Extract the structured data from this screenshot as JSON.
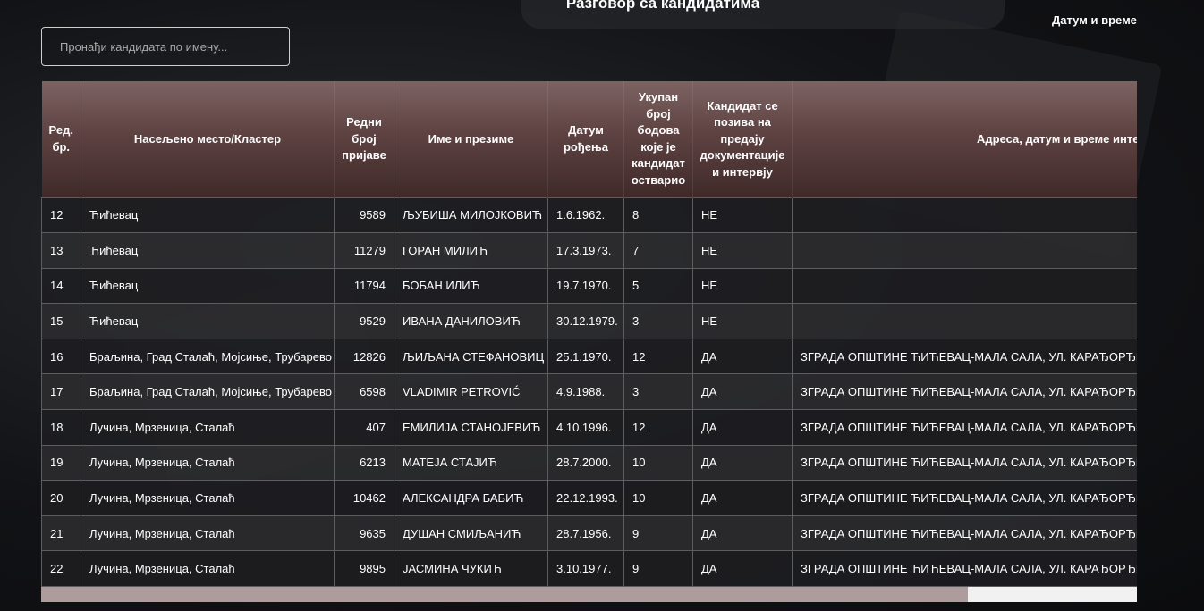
{
  "header": {
    "title": "Разговор са кандидатима",
    "date_label": "Датум и време"
  },
  "search": {
    "placeholder": "Пронађи кандидата по имену..."
  },
  "table": {
    "columns": [
      "Ред. бр.",
      "Насељено место/Кластер",
      "Редни број пријаве",
      "Име и презиме",
      "Датум рођења",
      "Укупан број бодова које је кандидат остварио",
      "Кандидат се позива на предају документације и интервју",
      "Адреса, датум и време интер"
    ],
    "rows": [
      [
        "12",
        "Ћићевац",
        "9589",
        "ЉУБИША МИЛОЈКОВИЋ",
        "1.6.1962.",
        "8",
        "НЕ",
        ""
      ],
      [
        "13",
        "Ћићевац",
        "11279",
        "ГОРАН МИЛИЋ",
        "17.3.1973.",
        "7",
        "НЕ",
        ""
      ],
      [
        "14",
        "Ћићевац",
        "11794",
        "БОБАН ИЛИЋ",
        "19.7.1970.",
        "5",
        "НЕ",
        ""
      ],
      [
        "15",
        "Ћићевац",
        "9529",
        "ИВАНА ДАНИЛОВИЋ",
        "30.12.1979.",
        "3",
        "НЕ",
        ""
      ],
      [
        "16",
        "Браљина, Град Сталаћ, Мојсиње, Трубарево",
        "12826",
        "ЉИЉАНА СТЕФАНОВИЦ",
        "25.1.1970.",
        "12",
        "ДА",
        "ЗГРАДА ОПШТИНЕ ЋИЋЕВАЦ-МАЛА САЛА, УЛ. КАРАЂОРЂЕВА"
      ],
      [
        "17",
        "Браљина, Град Сталаћ, Мојсиње, Трубарево",
        "6598",
        "VLADIMIR PETROVIĆ",
        "4.9.1988.",
        "3",
        "ДА",
        "ЗГРАДА ОПШТИНЕ ЋИЋЕВАЦ-МАЛА САЛА, УЛ. КАРАЂОРЂЕВА"
      ],
      [
        "18",
        "Лучина, Мрзеница, Сталаћ",
        "407",
        "ЕМИЛИЈА СТАНОЈЕВИЋ",
        "4.10.1996.",
        "12",
        "ДА",
        "ЗГРАДА ОПШТИНЕ ЋИЋЕВАЦ-МАЛА САЛА, УЛ. КАРАЂОРЂЕВА"
      ],
      [
        "19",
        "Лучина, Мрзеница, Сталаћ",
        "6213",
        "МАТЕЈА СТАЈИЋ",
        "28.7.2000.",
        "10",
        "ДА",
        "ЗГРАДА ОПШТИНЕ ЋИЋЕВАЦ-МАЛА САЛА, УЛ. КАРАЂОРЂЕВА"
      ],
      [
        "20",
        "Лучина, Мрзеница, Сталаћ",
        "10462",
        "АЛЕКСАНДРА БАБИЋ",
        "22.12.1993.",
        "10",
        "ДА",
        "ЗГРАДА ОПШТИНЕ ЋИЋЕВАЦ-МАЛА САЛА, УЛ. КАРАЂОРЂЕВА"
      ],
      [
        "21",
        "Лучина, Мрзеница, Сталаћ",
        "9635",
        "ДУШАН СМИЉАНИЋ",
        "28.7.1956.",
        "9",
        "ДА",
        "ЗГРАДА ОПШТИНЕ ЋИЋЕВАЦ-МАЛА САЛА, УЛ. КАРАЂОРЂЕВА"
      ],
      [
        "22",
        "Лучина, Мрзеница, Сталаћ",
        "9895",
        "ЈАСМИНА ЧУКИЋ",
        "3.10.1977.",
        "9",
        "ДА",
        "ЗГРАДА ОПШТИНЕ ЋИЋЕВАЦ-МАЛА САЛА, УЛ. КАРАЂОРЂЕВА"
      ]
    ]
  }
}
